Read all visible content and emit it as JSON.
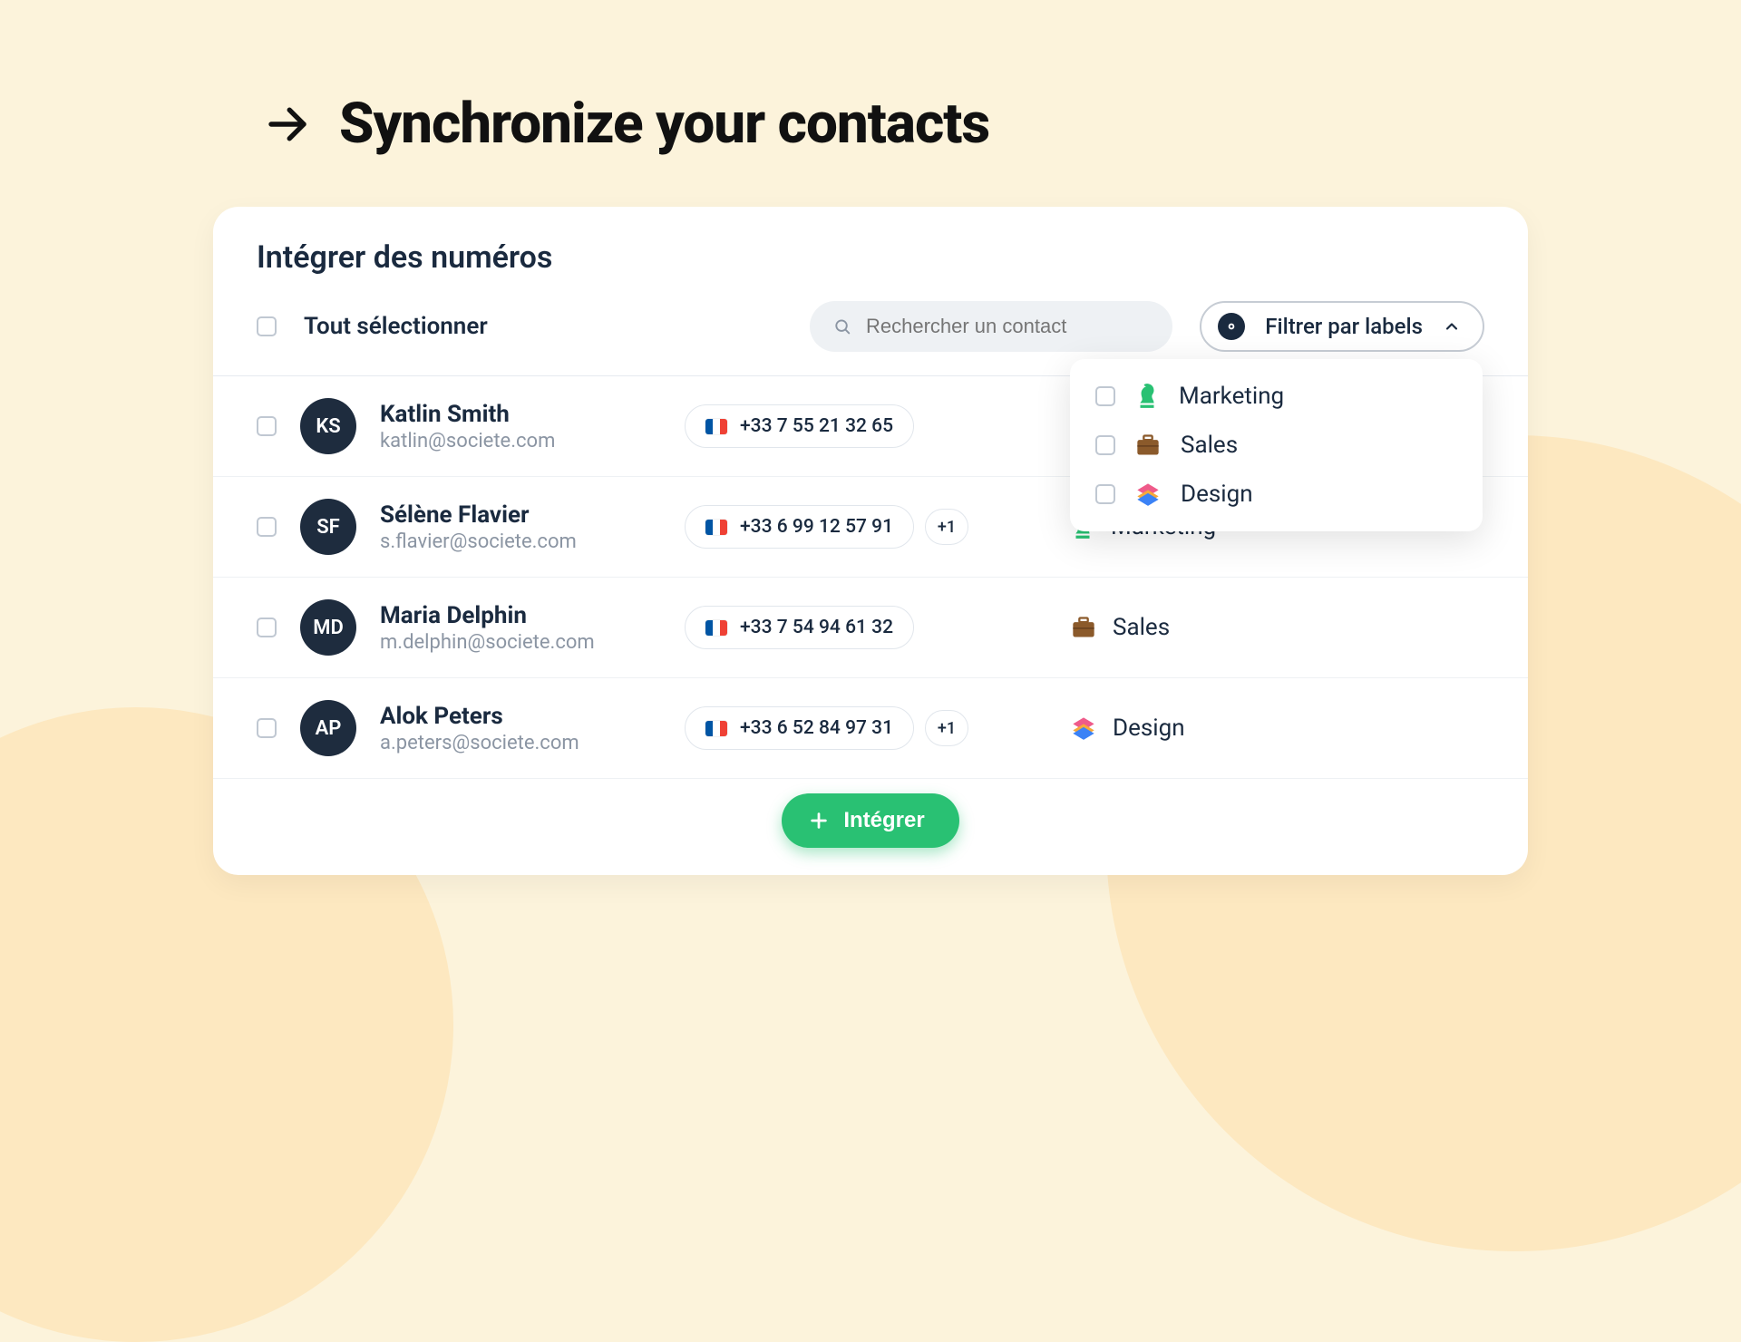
{
  "heading": "Synchronize your contacts",
  "card_title": "Intégrer des numéros",
  "select_all_label": "Tout sélectionner",
  "search_placeholder": "Rechercher un contact",
  "filter_label": "Filtrer par labels",
  "dropdown": {
    "items": [
      {
        "label": "Marketing",
        "icon": "chess"
      },
      {
        "label": "Sales",
        "icon": "briefcase"
      },
      {
        "label": "Design",
        "icon": "layers"
      }
    ]
  },
  "contacts": [
    {
      "initials": "KS",
      "name": "Katlin Smith",
      "email": "katlin@societe.com",
      "phone": "+33 7 55 21 32 65",
      "more": null,
      "tag": null,
      "tag_icon": null
    },
    {
      "initials": "SF",
      "name": "Sélène Flavier",
      "email": "s.flavier@societe.com",
      "phone": "+33 6 99 12 57 91",
      "more": "+1",
      "tag": "Marketing",
      "tag_icon": "chess"
    },
    {
      "initials": "MD",
      "name": "Maria Delphin",
      "email": "m.delphin@societe.com",
      "phone": "+33 7 54 94 61 32",
      "more": null,
      "tag": "Sales",
      "tag_icon": "briefcase"
    },
    {
      "initials": "AP",
      "name": "Alok Peters",
      "email": "a.peters@societe.com",
      "phone": "+33 6 52 84 97 31",
      "more": "+1",
      "tag": "Design",
      "tag_icon": "layers"
    }
  ],
  "cta_label": "Intégrer"
}
